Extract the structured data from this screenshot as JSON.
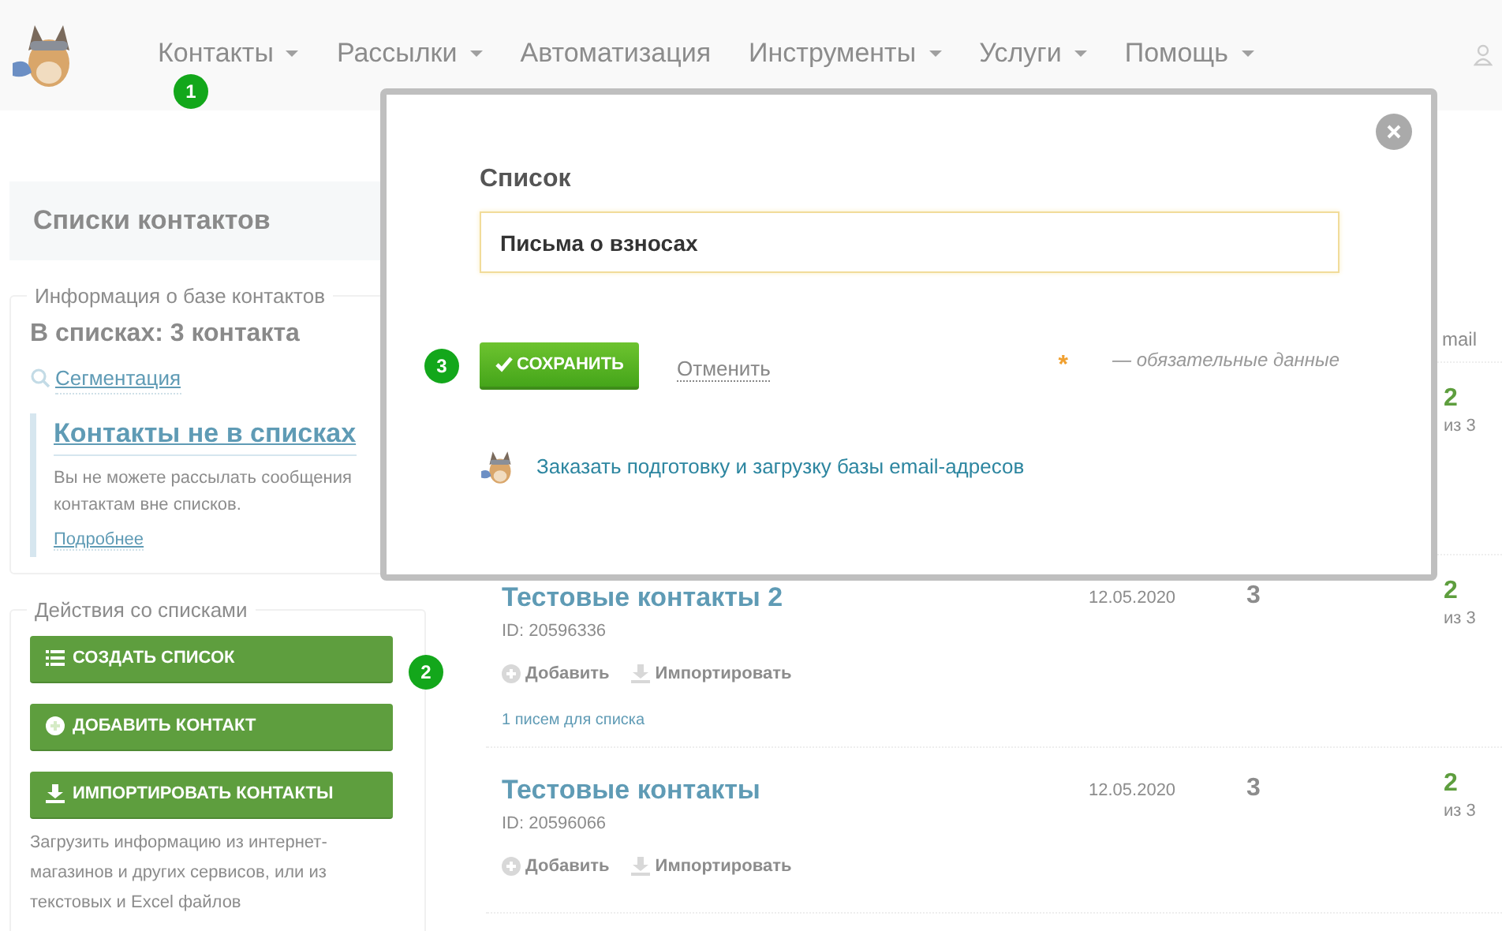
{
  "header": {
    "nav": [
      {
        "label": "Контакты",
        "dropdown": true,
        "step": "1"
      },
      {
        "label": "Рассылки",
        "dropdown": true
      },
      {
        "label": "Автоматизация",
        "dropdown": false
      },
      {
        "label": "Инструменты",
        "dropdown": true
      },
      {
        "label": "Услуги",
        "dropdown": true
      },
      {
        "label": "Помощь",
        "dropdown": true
      }
    ]
  },
  "sidebar": {
    "title": "Списки контактов",
    "info": {
      "legend": "Информация о базе контактов",
      "in_lists": "В списках: 3 контакта",
      "segmentation": "Сегментация",
      "not_in_lists": "Контакты не в списках",
      "text": "Вы не можете рассылать сообщения контактам вне списков.",
      "more": "Подробнее"
    },
    "actions": {
      "legend": "Действия со списками",
      "buttons": [
        {
          "label": "СОЗДАТЬ СПИСОК",
          "step": "2"
        },
        {
          "label": "ДОБАВИТЬ КОНТАКТ"
        },
        {
          "label": "ИМПОРТИРОВАТЬ КОНТАКТЫ"
        }
      ],
      "note": "Загрузить информацию из интернет-магазинов и других сервисов, или из текстовых и Excel файлов"
    }
  },
  "lists": {
    "column_header": "mail",
    "rows": [
      {
        "opened": "2",
        "of": "из 3"
      },
      {
        "name": "Тестовые контакты 2",
        "id": "ID: 20596336",
        "date": "12.05.2020",
        "count": "3",
        "opened": "2",
        "of": "из 3",
        "actions": [
          "Добавить",
          "Импортировать"
        ],
        "letters": "1 писем для списка"
      },
      {
        "name": "Тестовые контакты",
        "id": "ID: 20596066",
        "date": "12.05.2020",
        "count": "3",
        "opened": "2",
        "of": "из 3",
        "actions": [
          "Добавить",
          "Импортировать"
        ]
      }
    ]
  },
  "modal": {
    "label": "Список",
    "value": "Письма о взносах",
    "save": {
      "label": "СОХРАНИТЬ",
      "step": "3"
    },
    "cancel": "Отменить",
    "required_mark": "*",
    "required_note": "— обязательные данные",
    "order_link": "Заказать подготовку и загрузку базы email-адресов"
  }
}
